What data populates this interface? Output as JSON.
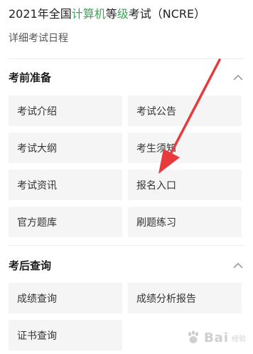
{
  "header": {
    "title_prefix": "2021年全国",
    "title_green_1": "计算机",
    "title_mid": "等",
    "title_green_2": "级",
    "title_suffix": "考试（NCRE）",
    "subtitle": "详细考试日程"
  },
  "colors": {
    "accent_green": "#3aa757",
    "tile_bg": "#f5f5f5",
    "arrow_red": "#e8393d"
  },
  "sections": [
    {
      "title": "考前准备",
      "icon": "chevron-up-icon",
      "items": [
        "考试介绍",
        "考试公告",
        "考试大纲",
        "考生须知",
        "考试资讯",
        "报名入口",
        "官方题库",
        "刷题练习"
      ]
    },
    {
      "title": "考后查询",
      "icon": "chevron-up-icon",
      "items": [
        "成绩查询",
        "成绩分析报告",
        "证书查询"
      ]
    }
  ],
  "watermark": {
    "text": "Bai",
    "sub": "经验"
  }
}
